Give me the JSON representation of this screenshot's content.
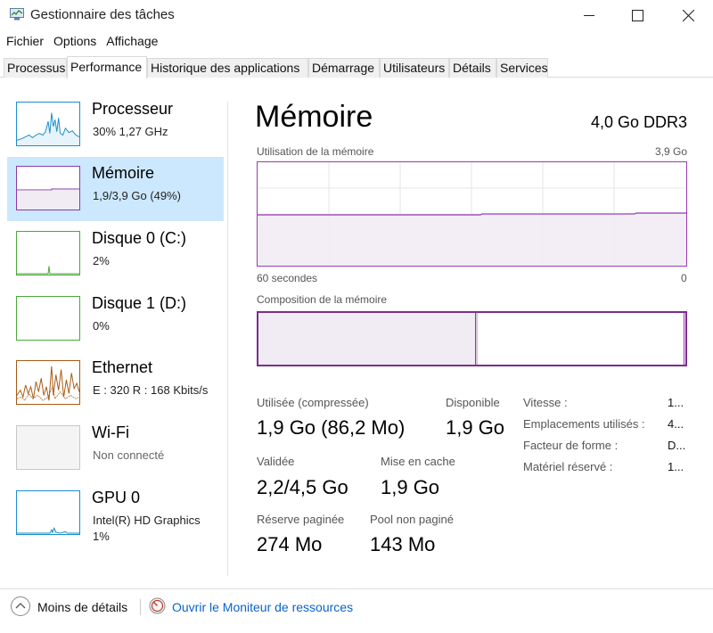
{
  "window": {
    "title": "Gestionnaire des tâches",
    "icon": "task-manager-icon"
  },
  "menu": [
    "Fichier",
    "Options",
    "Affichage"
  ],
  "tabs": [
    "Processus",
    "Performance",
    "Historique des applications",
    "Démarrage",
    "Utilisateurs",
    "Détails",
    "Services"
  ],
  "active_tab": "Performance",
  "sidebar": {
    "items": [
      {
        "name": "Processeur",
        "sub": "30%  1,27 GHz",
        "color": "#1a8fc9"
      },
      {
        "name": "Mémoire",
        "sub": "1,9/3,9 Go (49%)",
        "color": "#8b3aa4",
        "selected": true
      },
      {
        "name": "Disque 0 (C:)",
        "sub": "2%",
        "color": "#4aa83a"
      },
      {
        "name": "Disque 1 (D:)",
        "sub": "0%",
        "color": "#4aa83a"
      },
      {
        "name": "Ethernet",
        "sub": "E : 320  R : 168 Kbits/s",
        "color": "#a65a12"
      },
      {
        "name": "Wi-Fi",
        "sub": "Non connecté",
        "color": "#a65a12"
      },
      {
        "name": "GPU 0",
        "sub": "Intel(R) HD Graphics",
        "sub2": "1%",
        "color": "#1a8fc9"
      }
    ]
  },
  "main": {
    "title": "Mémoire",
    "spec": "4,0 Go DDR3",
    "usage_graph": {
      "label": "Utilisation de la mémoire",
      "max_label": "3,9 Go",
      "time_label": "60 secondes",
      "min_label": "0",
      "level_fraction": 0.49,
      "line_color": "#9a38b3",
      "fill_color": "#f1ebf3"
    },
    "composition": {
      "label": "Composition de la mémoire",
      "in_use_fraction": 0.51,
      "modified_fraction": 0.005,
      "standby_fraction": 0.485
    },
    "stats": {
      "used_label": "Utilisée (compressée)",
      "used_value": "1,9 Go (86,2 Mo)",
      "available_label": "Disponible",
      "available_value": "1,9 Go",
      "committed_label": "Validée",
      "committed_value": "2,2/4,5 Go",
      "cached_label": "Mise en cache",
      "cached_value": "1,9 Go",
      "paged_label": "Réserve paginée",
      "paged_value": "274 Mo",
      "nonpaged_label": "Pool non paginé",
      "nonpaged_value": "143 Mo"
    },
    "specs": [
      {
        "label": "Vitesse :",
        "value": "1..."
      },
      {
        "label": "Emplacements utilisés :",
        "value": "4..."
      },
      {
        "label": "Facteur de forme :",
        "value": "D..."
      },
      {
        "label": "Matériel réservé :",
        "value": "1..."
      }
    ]
  },
  "footer": {
    "less_details": "Moins de détails",
    "resource_monitor": "Ouvrir le Moniteur de ressources"
  }
}
